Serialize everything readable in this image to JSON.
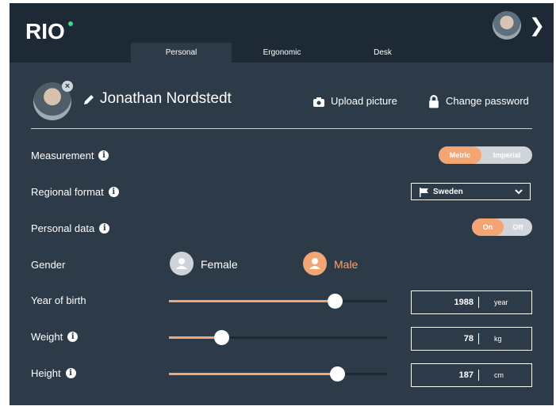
{
  "app": {
    "logo": "RIO"
  },
  "tabs": [
    {
      "label": "Personal",
      "active": true
    },
    {
      "label": "Ergonomic",
      "active": false
    },
    {
      "label": "Desk",
      "active": false
    }
  ],
  "profile": {
    "name": "Jonathan Nordstedt",
    "upload_label": "Upload picture",
    "password_label": "Change password"
  },
  "settings": {
    "measurement": {
      "label": "Measurement",
      "options": [
        "Metric",
        "Imperial"
      ],
      "selected": "Metric"
    },
    "regional": {
      "label": "Regional format",
      "value": "Sweden"
    },
    "personal_data": {
      "label": "Personal data",
      "options": [
        "On",
        "Off"
      ],
      "selected": "On"
    },
    "gender": {
      "label": "Gender",
      "options": [
        "Female",
        "Male"
      ],
      "selected": "Male"
    },
    "year_of_birth": {
      "label": "Year of birth",
      "value": "1988",
      "unit": "year",
      "slider_fraction": 0.76
    },
    "weight": {
      "label": "Weight",
      "value": "78",
      "unit": "kg",
      "slider_fraction": 0.24
    },
    "height": {
      "label": "Height",
      "value": "187",
      "unit": "cm",
      "slider_fraction": 0.77
    }
  },
  "colors": {
    "background": "#2d3a48",
    "topbar": "#1d2a36",
    "accent": "#f4a574",
    "toggle_off": "#d0d5da",
    "logo_dot": "#3ddc84"
  }
}
